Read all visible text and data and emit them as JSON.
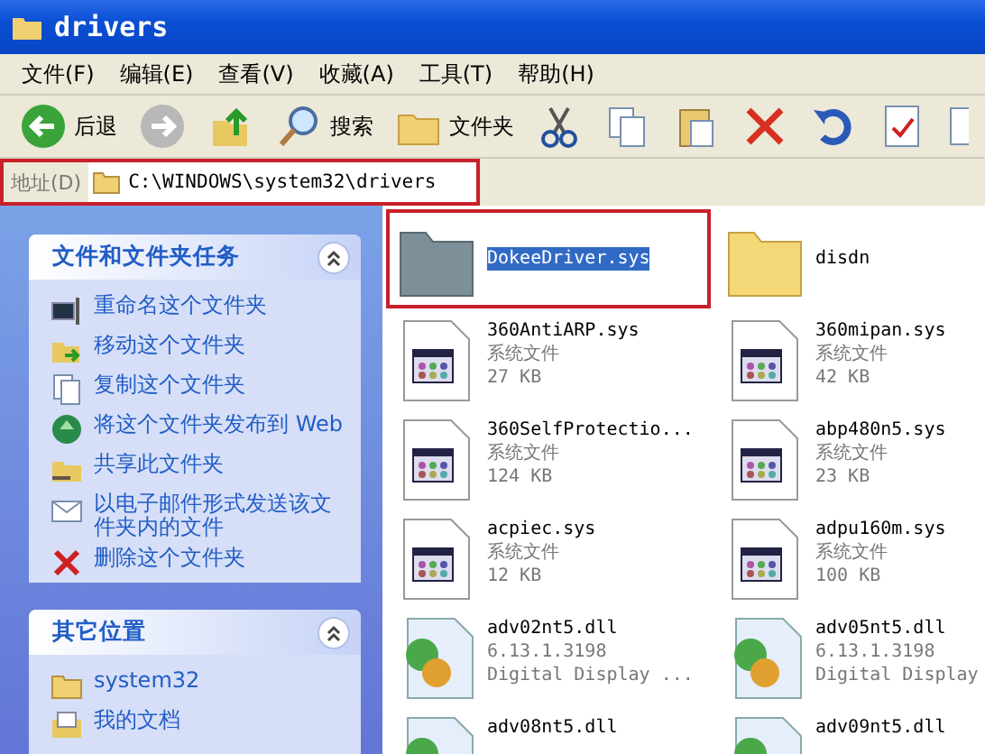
{
  "window": {
    "title": "drivers"
  },
  "menu": [
    "文件(F)",
    "编辑(E)",
    "查看(V)",
    "收藏(A)",
    "工具(T)",
    "帮助(H)"
  ],
  "toolbar": [
    {
      "kind": "back",
      "label": "后退"
    },
    {
      "kind": "forward"
    },
    {
      "kind": "up"
    },
    {
      "kind": "search",
      "label": "搜索"
    },
    {
      "kind": "folders",
      "label": "文件夹"
    },
    {
      "kind": "cut"
    },
    {
      "kind": "copy"
    },
    {
      "kind": "paste"
    },
    {
      "kind": "delete"
    },
    {
      "kind": "undo"
    },
    {
      "kind": "properties"
    },
    {
      "kind": "views"
    }
  ],
  "address": {
    "label": "地址(D)",
    "value": "C:\\WINDOWS\\system32\\drivers",
    "highlighted": true
  },
  "sidebar": [
    {
      "title": "文件和文件夹任务",
      "expanded": true,
      "items": [
        {
          "kind": "rename",
          "label": "重命名这个文件夹"
        },
        {
          "kind": "move",
          "label": "移动这个文件夹"
        },
        {
          "kind": "copy",
          "label": "复制这个文件夹"
        },
        {
          "kind": "web",
          "label": "将这个文件夹发布到 Web"
        },
        {
          "kind": "share",
          "label": "共享此文件夹"
        },
        {
          "kind": "mail",
          "label": "以电子邮件形式发送该文件夹内的文件"
        },
        {
          "kind": "delete",
          "label": "删除这个文件夹"
        }
      ]
    },
    {
      "title": "其它位置",
      "expanded": true,
      "items": [
        {
          "kind": "folder",
          "label": "system32"
        },
        {
          "kind": "docs",
          "label": "我的文档"
        }
      ]
    }
  ],
  "files": [
    {
      "kind": "grey-folder",
      "name": "DokeeDriver.sys",
      "selected": true,
      "highlighted": true
    },
    {
      "kind": "folder",
      "name": "disdn",
      "selected": false,
      "highlighted": false
    },
    {
      "kind": "sys",
      "name": "360AntiARP.sys",
      "type": "系统文件",
      "size": "27 KB",
      "selected": false,
      "highlighted": false
    },
    {
      "kind": "sys",
      "name": "360mipan.sys",
      "type": "系统文件",
      "size": "42 KB",
      "selected": false,
      "highlighted": false
    },
    {
      "kind": "sys",
      "name": "360SelfProtectio...",
      "type": "系统文件",
      "size": "124 KB",
      "selected": false,
      "highlighted": false
    },
    {
      "kind": "sys",
      "name": "abp480n5.sys",
      "type": "系统文件",
      "size": "23 KB",
      "selected": false,
      "highlighted": false
    },
    {
      "kind": "sys",
      "name": "acpiec.sys",
      "type": "系统文件",
      "size": "12 KB",
      "selected": false,
      "highlighted": false
    },
    {
      "kind": "sys",
      "name": "adpu160m.sys",
      "type": "系统文件",
      "size": "100 KB",
      "selected": false,
      "highlighted": false
    },
    {
      "kind": "dll",
      "name": "adv02nt5.dll",
      "type": "6.13.1.3198",
      "size": "Digital Display ...",
      "selected": false,
      "highlighted": false
    },
    {
      "kind": "dll",
      "name": "adv05nt5.dll",
      "type": "6.13.1.3198",
      "size": "Digital Display",
      "selected": false,
      "highlighted": false
    },
    {
      "kind": "dll",
      "name": "adv08nt5.dll",
      "selected": false,
      "highlighted": false
    },
    {
      "kind": "dll",
      "name": "adv09nt5.dll",
      "selected": false,
      "highlighted": false
    }
  ]
}
